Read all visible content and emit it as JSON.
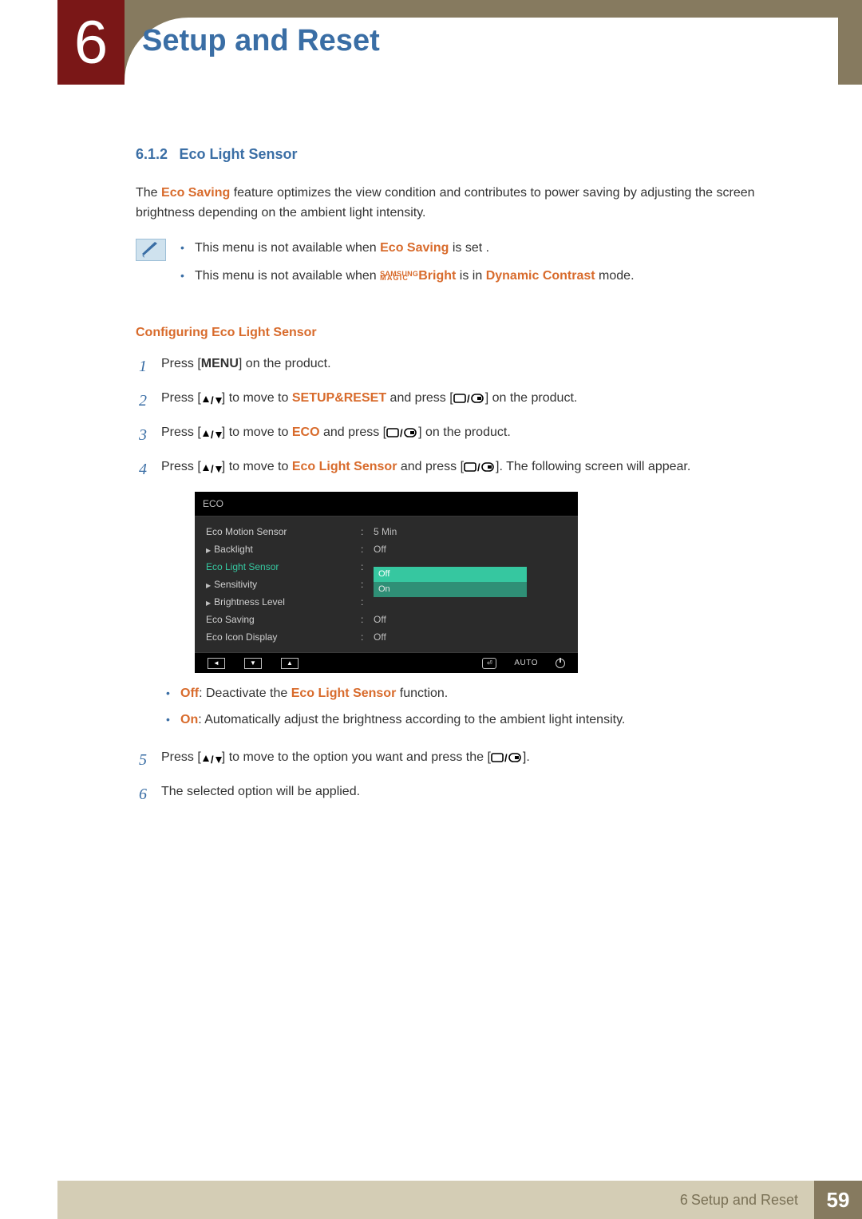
{
  "header": {
    "chapter_number": "6",
    "title": "Setup and Reset"
  },
  "section": {
    "number": "6.1.2",
    "title": "Eco Light Sensor"
  },
  "intro": {
    "p1a": "The ",
    "term_eco_saving": "Eco Saving",
    "p1b": " feature optimizes the view condition and contributes to power saving by adjusting the screen brightness depending on the ambient light intensity."
  },
  "notes": {
    "n1a": "This menu is not available when ",
    "n1_term": "Eco Saving",
    "n1b": " is set .",
    "n2a": "This menu is not available when ",
    "magic_top": "SAMSUNG",
    "magic_bot": "MAGIC",
    "n2_bright": "Bright",
    "n2b": " is in ",
    "n2_dc": "Dynamic Contrast",
    "n2c": " mode."
  },
  "subhead": "Configuring Eco Light Sensor",
  "steps": {
    "s1_a": "Press [",
    "s1_menu": "MENU",
    "s1_b": "] on the product.",
    "s2_a": "Press [",
    "s2_b": "] to move to ",
    "s2_term": "SETUP&RESET",
    "s2_c": " and press [",
    "s2_d": "] on the product.",
    "s3_a": "Press [",
    "s3_b": "] to move to ",
    "s3_term": "ECO",
    "s3_c": " and press [",
    "s3_d": "] on the product.",
    "s4_a": "Press [",
    "s4_b": "] to move to ",
    "s4_term": "Eco Light Sensor",
    "s4_c": " and press [",
    "s4_d": "]. The following screen will appear.",
    "off_label": "Off",
    "off_desc_a": ": Deactivate the ",
    "off_desc_term": "Eco Light Sensor",
    "off_desc_b": " function.",
    "on_label": "On",
    "on_desc": ": Automatically adjust the brightness according to the ambient light intensity.",
    "s5_a": "Press [",
    "s5_b": "] to move to the option you want and press the [",
    "s5_c": "].",
    "s6": "The selected option will be applied."
  },
  "osd": {
    "title": "ECO",
    "rows": [
      {
        "label": "Eco Motion Sensor",
        "value": "5 Min",
        "sub": false,
        "hi": false
      },
      {
        "label": "Backlight",
        "value": "Off",
        "sub": true,
        "hi": false
      },
      {
        "label": "Eco Light Sensor",
        "value": "",
        "sub": false,
        "hi": true,
        "dropdown": true
      },
      {
        "label": "Sensitivity",
        "value": "",
        "sub": true,
        "hi": false
      },
      {
        "label": "Brightness Level",
        "value": "",
        "sub": true,
        "hi": false
      },
      {
        "label": "Eco Saving",
        "value": "Off",
        "sub": false,
        "hi": false
      },
      {
        "label": "Eco Icon Display",
        "value": "Off",
        "sub": false,
        "hi": false
      }
    ],
    "dropdown": {
      "selected": "Off",
      "other": "On"
    },
    "footer_auto": "AUTO"
  },
  "footer": {
    "chapter_prefix": "6",
    "chapter_label": " Setup and Reset",
    "page": "59"
  }
}
